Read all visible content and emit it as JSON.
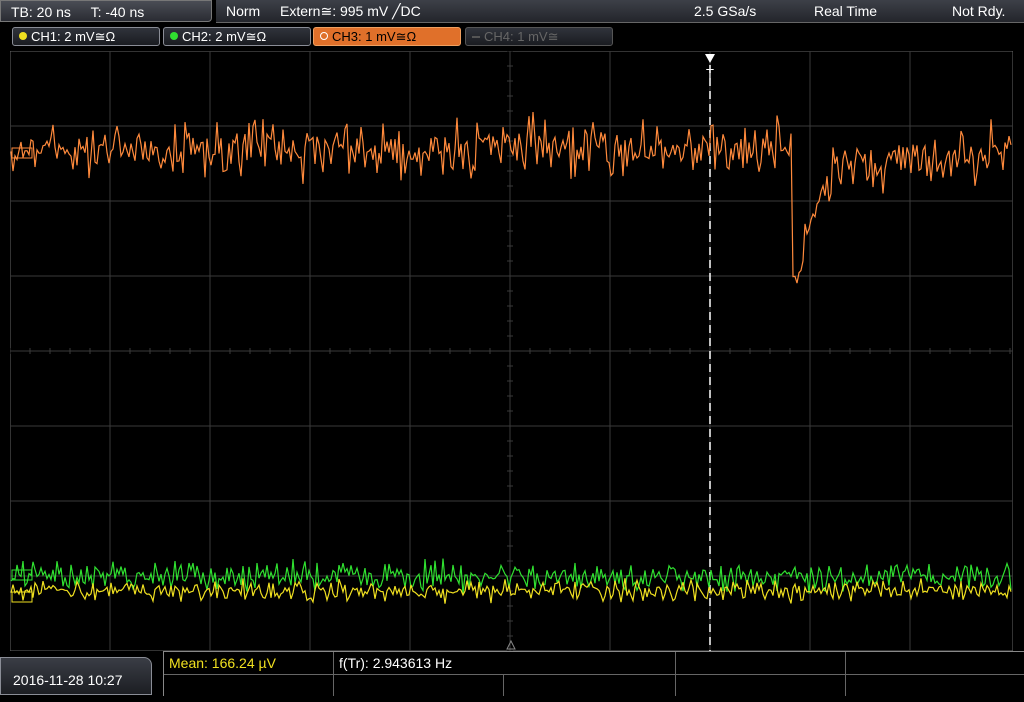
{
  "status_bar": {
    "timebase": "TB: 20 ns",
    "trigger_time": "T: -40 ns",
    "trigger_mode": "Norm",
    "trigger_source": "Extern≅: 995 mV ╱DC",
    "sample_rate": "2.5 GSa/s",
    "acquisition_mode": "Real Time",
    "state": "Not Rdy."
  },
  "channels": [
    {
      "label": "CH1: 2 mV≅Ω",
      "color": "#f0e020",
      "active": true
    },
    {
      "label": "CH2: 2 mV≅Ω",
      "color": "#30e030",
      "active": true
    },
    {
      "label": "CH3: 1 mV≅Ω",
      "color": "#ff8a3c",
      "active": true
    },
    {
      "label": "CH4: 1 mV≅",
      "color": "#555555",
      "active": false
    }
  ],
  "screen": {
    "trigger_marker": "T",
    "trace_colors": {
      "ch1": "#f0e020",
      "ch2": "#30e030",
      "ch3": "#ff8a3c"
    },
    "grid_color": "#3a3a3a"
  },
  "footer": {
    "datetime": "2016-11-28 10:27",
    "measurements": [
      {
        "label": "Mean: 166.24 µV",
        "color": "#f0e020"
      },
      {
        "label": "f(Tr): 2.943613 Hz",
        "color": "#ffffff"
      }
    ]
  }
}
